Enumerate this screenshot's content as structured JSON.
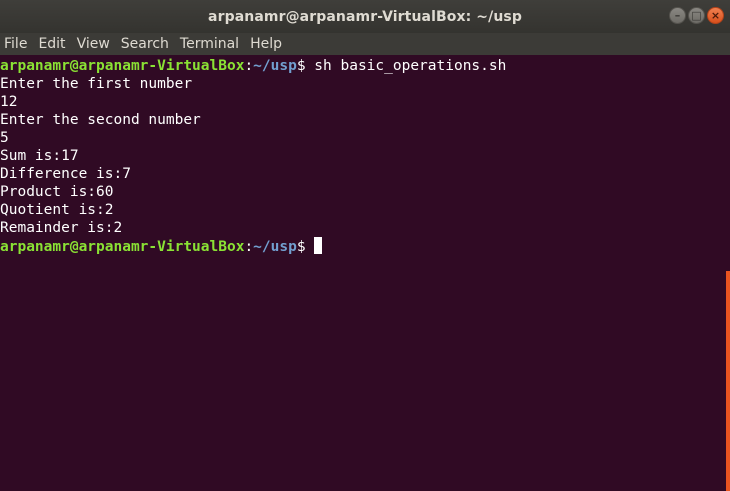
{
  "window": {
    "title": "arpanamr@arpanamr-VirtualBox: ~/usp",
    "buttons": {
      "minimize": "–",
      "maximize": "□",
      "close": "×"
    }
  },
  "menu": {
    "items": [
      {
        "label": "File"
      },
      {
        "label": "Edit"
      },
      {
        "label": "View"
      },
      {
        "label": "Search"
      },
      {
        "label": "Terminal"
      },
      {
        "label": "Help"
      }
    ]
  },
  "terminal": {
    "prompt_user": "arpanamr@arpanamr-VirtualBox",
    "prompt_sep": ":",
    "prompt_path": "~/usp",
    "prompt_symbol": "$",
    "command": " sh basic_operations.sh",
    "output": [
      "Enter the first number",
      "12",
      "Enter the second number",
      "5",
      "Sum is:17",
      "Difference is:7",
      "Product is:60",
      "Quotient is:2",
      "Remainder is:2"
    ],
    "colors": {
      "background": "#300a24",
      "prompt_user": "#8ae234",
      "prompt_path": "#729fcf",
      "text": "#ffffff",
      "scrollbar": "#e95420"
    }
  }
}
